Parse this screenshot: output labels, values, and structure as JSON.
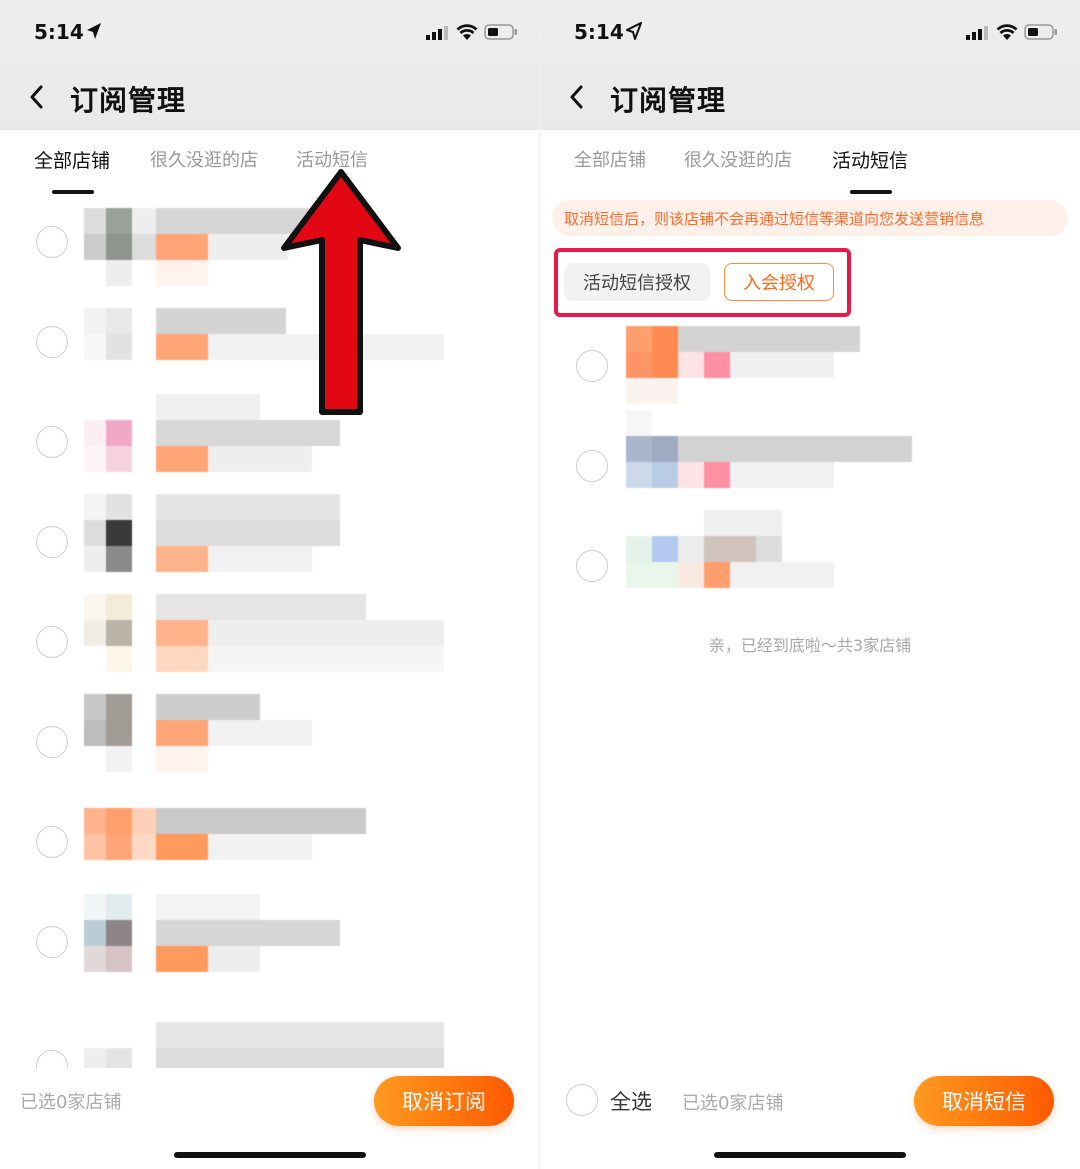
{
  "left": {
    "status": {
      "time": "5:14"
    },
    "title": "订阅管理",
    "tabs": [
      {
        "label": "全部店铺",
        "active": true
      },
      {
        "label": "很久没逛的店",
        "active": false
      },
      {
        "label": "活动短信",
        "active": false
      }
    ],
    "footer": {
      "selected_text": "已选0家店铺",
      "button_label": "取消订阅"
    }
  },
  "right": {
    "status": {
      "time": "5:14"
    },
    "title": "订阅管理",
    "tabs": [
      {
        "label": "全部店铺",
        "active": false
      },
      {
        "label": "很久没逛的店",
        "active": false
      },
      {
        "label": "活动短信",
        "active": true
      }
    ],
    "notice": "取消短信后，则该店铺不会再通过短信等渠道向您发送营销信息",
    "chips": [
      {
        "label": "活动短信授权",
        "active": false
      },
      {
        "label": "入会授权",
        "active": true
      }
    ],
    "end_text": "亲，已经到底啦～共3家店铺",
    "footer": {
      "select_all_label": "全选",
      "selected_text": "已选0家店铺",
      "button_label": "取消短信"
    }
  },
  "colors": {
    "accent": "#ff6a1a",
    "highlight": "#e8194a",
    "arrow": "#e30613"
  }
}
